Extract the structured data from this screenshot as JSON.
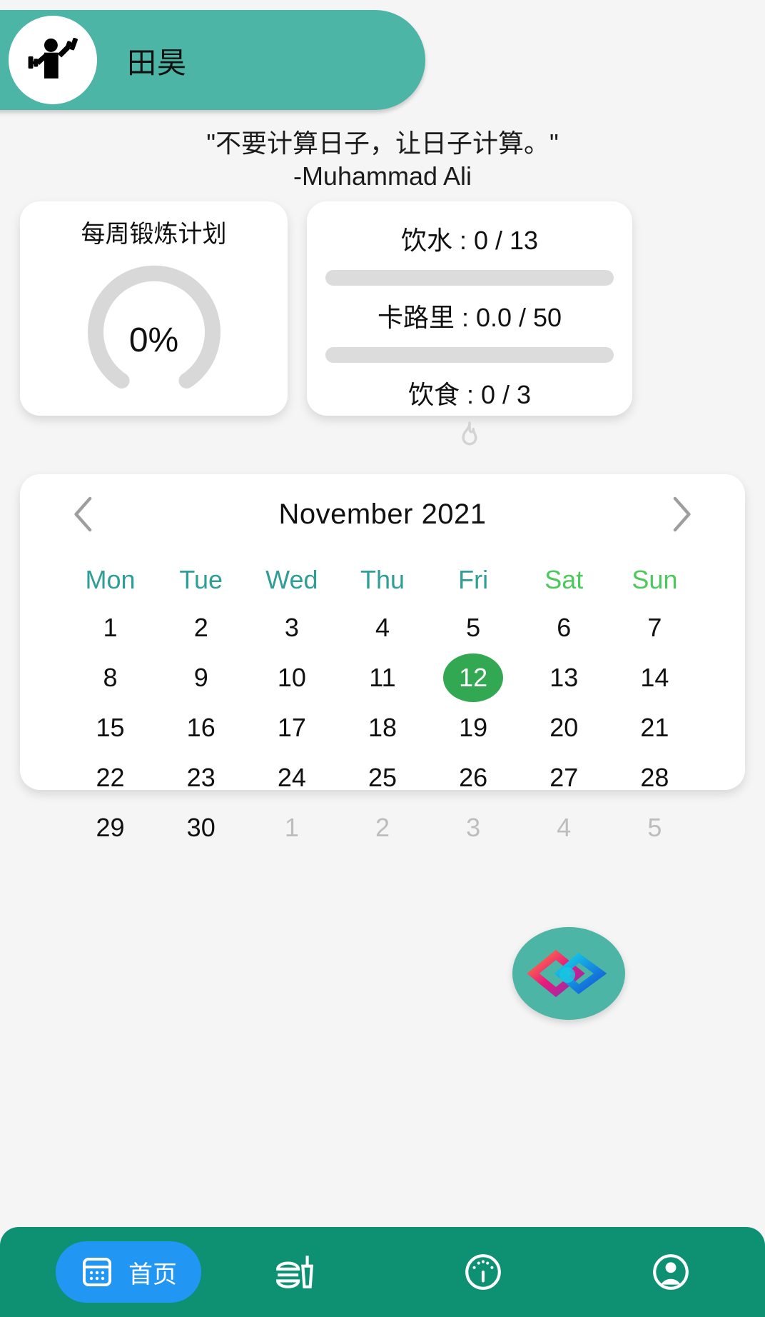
{
  "header": {
    "user_name": "田昊",
    "avatar_icon": "weightlifter-icon",
    "bar_color": "#4cb5a5"
  },
  "quote": {
    "text": "\"不要计算日子，让日子计算。\"",
    "author": "-Muhammad Ali"
  },
  "weekly_card": {
    "title": "每周锻炼计划",
    "percent_label": "0%",
    "percent_value": 0,
    "track_color": "#d8d8d8"
  },
  "stats_card": {
    "water": "饮水 : 0 / 13",
    "water_progress": 0,
    "calories": "卡路里 : 0.0 / 50",
    "calories_progress": 0,
    "diet": "饮食 : 0 / 3",
    "flame_icon": "flame-icon"
  },
  "calendar": {
    "month_label": "November 2021",
    "prev_icon": "chevron-left-icon",
    "next_icon": "chevron-right-icon",
    "weekdays": [
      "Mon",
      "Tue",
      "Wed",
      "Thu",
      "Fri",
      "Sat",
      "Sun"
    ],
    "weekend_color": "#4cc95c",
    "weekday_color": "#2e9e96",
    "selected_day": 12,
    "selected_color": "#33a852",
    "days": [
      {
        "n": "1",
        "muted": false
      },
      {
        "n": "2",
        "muted": false
      },
      {
        "n": "3",
        "muted": false
      },
      {
        "n": "4",
        "muted": false
      },
      {
        "n": "5",
        "muted": false
      },
      {
        "n": "6",
        "muted": false
      },
      {
        "n": "7",
        "muted": false
      },
      {
        "n": "8",
        "muted": false
      },
      {
        "n": "9",
        "muted": false
      },
      {
        "n": "10",
        "muted": false
      },
      {
        "n": "11",
        "muted": false
      },
      {
        "n": "12",
        "muted": false,
        "today": true
      },
      {
        "n": "13",
        "muted": false
      },
      {
        "n": "14",
        "muted": false
      },
      {
        "n": "15",
        "muted": false
      },
      {
        "n": "16",
        "muted": false
      },
      {
        "n": "17",
        "muted": false
      },
      {
        "n": "18",
        "muted": false
      },
      {
        "n": "19",
        "muted": false
      },
      {
        "n": "20",
        "muted": false
      },
      {
        "n": "21",
        "muted": false
      },
      {
        "n": "22",
        "muted": false
      },
      {
        "n": "23",
        "muted": false
      },
      {
        "n": "24",
        "muted": false
      },
      {
        "n": "25",
        "muted": false
      },
      {
        "n": "26",
        "muted": false
      },
      {
        "n": "27",
        "muted": false
      },
      {
        "n": "28",
        "muted": false
      },
      {
        "n": "29",
        "muted": false
      },
      {
        "n": "30",
        "muted": false
      },
      {
        "n": "1",
        "muted": true
      },
      {
        "n": "2",
        "muted": true
      },
      {
        "n": "3",
        "muted": true
      },
      {
        "n": "4",
        "muted": true
      },
      {
        "n": "5",
        "muted": true
      }
    ]
  },
  "fab": {
    "icon": "diamond-logo-icon",
    "background": "#4cb5a5"
  },
  "bottom_nav": {
    "background": "#0d9172",
    "active_color": "#2196f3",
    "items": [
      {
        "label": "首页",
        "icon": "calendar-icon",
        "active": true
      },
      {
        "label": "",
        "icon": "food-drink-icon",
        "active": false
      },
      {
        "label": "",
        "icon": "speedometer-icon",
        "active": false
      },
      {
        "label": "",
        "icon": "profile-icon",
        "active": false
      }
    ]
  }
}
